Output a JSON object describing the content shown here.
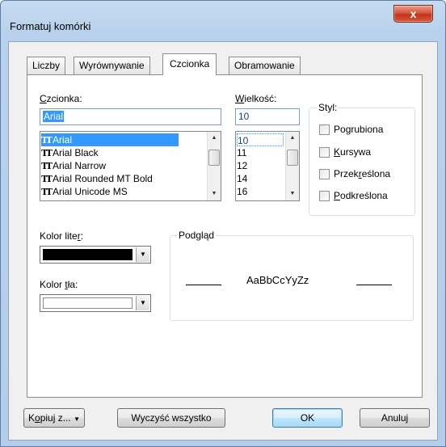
{
  "window": {
    "title": "Formatuj komórki",
    "close_glyph": "x"
  },
  "tabs": [
    {
      "label": "Liczby"
    },
    {
      "label": "Wyrównywanie"
    },
    {
      "label": "Czcionka",
      "active": true
    },
    {
      "label": "Obramowanie"
    }
  ],
  "font": {
    "label": "Czcionka:",
    "label_ul": "C",
    "label_rest": "zcionka:",
    "input_value": "Arial",
    "items": [
      "Arial",
      "Arial Black",
      "Arial Narrow",
      "Arial Rounded MT Bold",
      "Arial Unicode MS"
    ],
    "selected": "Arial",
    "icon_glyph": "TT"
  },
  "size": {
    "label_ul": "W",
    "label_rest": "ielkość:",
    "input_value": "10",
    "items": [
      "10",
      "11",
      "12",
      "14",
      "16"
    ],
    "selected": "10"
  },
  "style": {
    "title": "Styl:",
    "options": [
      {
        "pre": "Po",
        "ul": "g",
        "post": "rubiona",
        "checked": false
      },
      {
        "pre": "",
        "ul": "K",
        "post": "ursywa",
        "checked": false
      },
      {
        "pre": "Przek",
        "ul": "r",
        "post": "eślona",
        "checked": false
      },
      {
        "pre": "",
        "ul": "P",
        "post": "odkreślona",
        "checked": false
      }
    ]
  },
  "font_color": {
    "pre": "Kolor lite",
    "ul": "r",
    "post": ":",
    "value": "#000000"
  },
  "bg_color": {
    "pre": "Kolor ",
    "ul": "t",
    "post": "ła:",
    "value": "#ffffff"
  },
  "preview": {
    "title": "Podgląd",
    "sample": "AaBbCcYyZz"
  },
  "buttons": {
    "copy_pre": "K",
    "copy_ul": "o",
    "copy_post": "piuj z...",
    "clear": "Wyczyść wszystko",
    "ok": "OK",
    "cancel": "Anuluj"
  }
}
